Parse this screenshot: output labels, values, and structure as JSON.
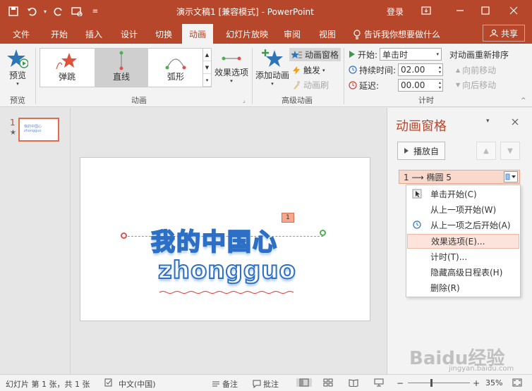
{
  "titlebar": {
    "title": "演示文稿1 [兼容模式] - PowerPoint",
    "login": "登录"
  },
  "tabs": [
    "文件",
    "开始",
    "插入",
    "设计",
    "切换",
    "动画",
    "幻灯片放映",
    "审阅",
    "视图"
  ],
  "active_tab": "动画",
  "tellme": "告诉我你想要做什么",
  "share": "共享",
  "ribbon": {
    "preview_label": "预览",
    "preview_group": "预览",
    "animation_items": [
      "弹跳",
      "直线",
      "弧形"
    ],
    "selected_animation": "直线",
    "effect_options": "效果选项",
    "animation_group": "动画",
    "add_animation": "添加动画",
    "animation_pane_btn": "动画窗格",
    "trigger": "触发",
    "animation_painter": "动画刷",
    "advanced_group": "高级动画",
    "start_label": "开始:",
    "start_value": "单击时",
    "duration_label": "持续时间:",
    "duration_value": "02.00",
    "delay_label": "延迟:",
    "delay_value": "00.00",
    "reorder_label": "对动画重新排序",
    "move_earlier": "向前移动",
    "move_later": "向后移动",
    "timing_group": "计时"
  },
  "thumbnails": {
    "slide_number": "1",
    "star": "★"
  },
  "slide": {
    "title_cn": "我的中国心",
    "title_en": "zhongguo",
    "anim_tag": "1",
    "thumb_line1": "我的中国心",
    "thumb_line2": "zhongguo"
  },
  "pane": {
    "title": "动画窗格",
    "play_button": "播放自",
    "item_label": "1 ⟶ 椭圆 5"
  },
  "context_menu": {
    "items": [
      "单击开始(C)",
      "从上一项开始(W)",
      "从上一项之后开始(A)",
      "效果选项(E)...",
      "计时(T)...",
      "隐藏高级日程表(H)",
      "删除(R)"
    ],
    "highlighted": "效果选项(E)..."
  },
  "statusbar": {
    "slide_info": "幻灯片 第 1 张，共 1 张",
    "language": "中文(中国)",
    "notes": "备注",
    "comments": "批注",
    "zoom": "35%"
  },
  "watermark": {
    "text": "Baidu经验",
    "url": "jingyan.baidu.com"
  },
  "colors": {
    "accent": "#b7472a",
    "pane_highlight": "#f9d9cc",
    "slide_text_outline": "#2c6fc7"
  }
}
